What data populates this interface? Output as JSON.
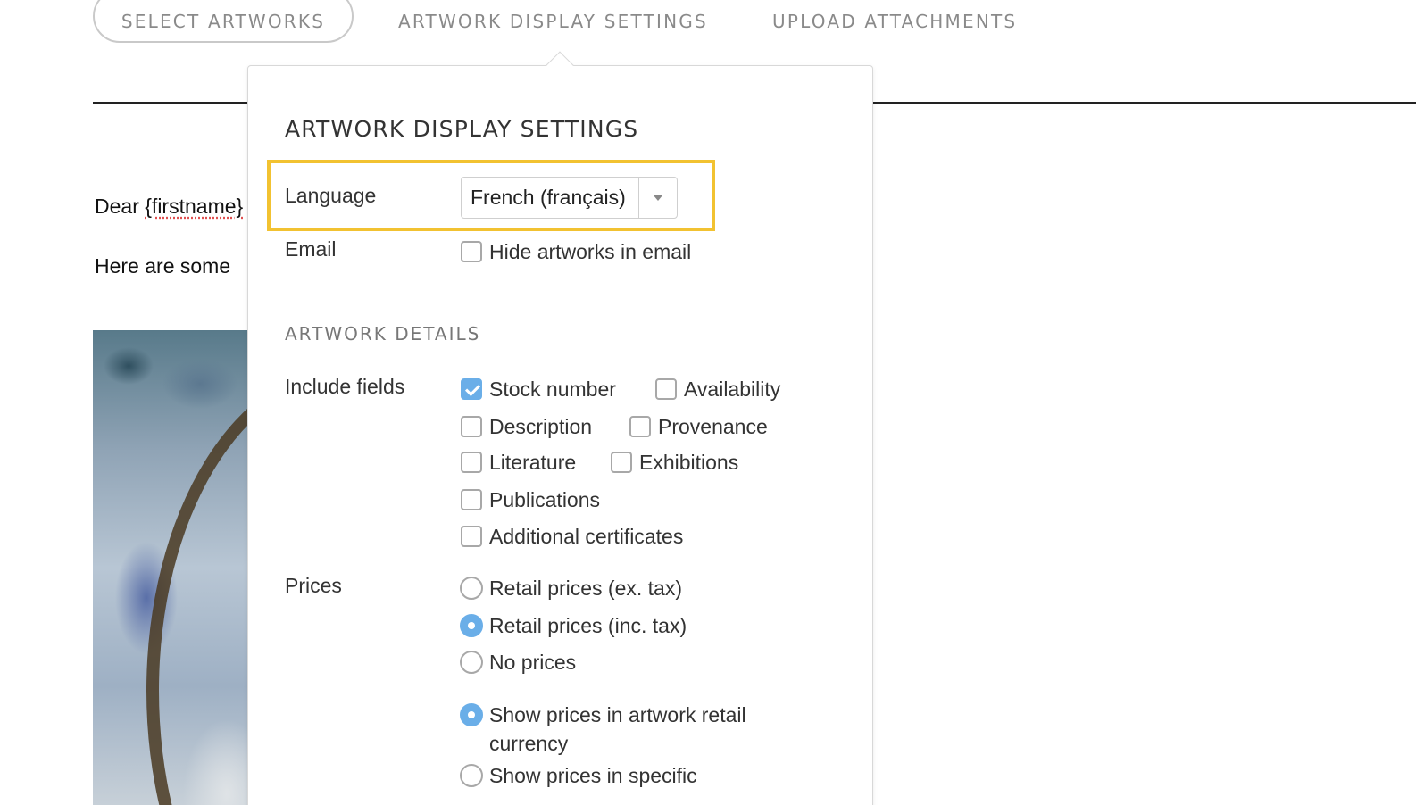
{
  "tabs": {
    "select_artworks": "SELECT ARTWORKS",
    "artwork_display_settings": "ARTWORK DISPLAY SETTINGS",
    "upload_attachments": "UPLOAD ATTACHMENTS"
  },
  "email": {
    "greeting_prefix": "Dear ",
    "greeting_tag": "{firstname}",
    "intro": "Here are some "
  },
  "popover": {
    "title": "ARTWORK DISPLAY SETTINGS",
    "language": {
      "label": "Language",
      "selected": "French (français)"
    },
    "email": {
      "label": "Email",
      "hide_option": "Hide artworks in email",
      "hide_checked": false
    },
    "artwork_details_title": "ARTWORK DETAILS",
    "include_fields": {
      "label": "Include fields",
      "options": [
        {
          "label": "Stock number",
          "checked": true
        },
        {
          "label": "Availability",
          "checked": false
        },
        {
          "label": "Description",
          "checked": false
        },
        {
          "label": "Provenance",
          "checked": false
        },
        {
          "label": "Literature",
          "checked": false
        },
        {
          "label": "Exhibitions",
          "checked": false
        },
        {
          "label": "Publications",
          "checked": false
        },
        {
          "label": "Additional certificates",
          "checked": false
        }
      ]
    },
    "prices": {
      "label": "Prices",
      "options": [
        {
          "label": "Retail prices (ex. tax)",
          "selected": false
        },
        {
          "label": "Retail prices (inc. tax)",
          "selected": true
        },
        {
          "label": "No prices",
          "selected": false
        }
      ],
      "currency_options": [
        {
          "label": "Show prices in artwork retail currency",
          "selected": true
        },
        {
          "label": "Show prices in specific",
          "selected": false
        }
      ]
    }
  },
  "colors": {
    "accent": "#6aaee8",
    "highlight": "#f2c231"
  }
}
